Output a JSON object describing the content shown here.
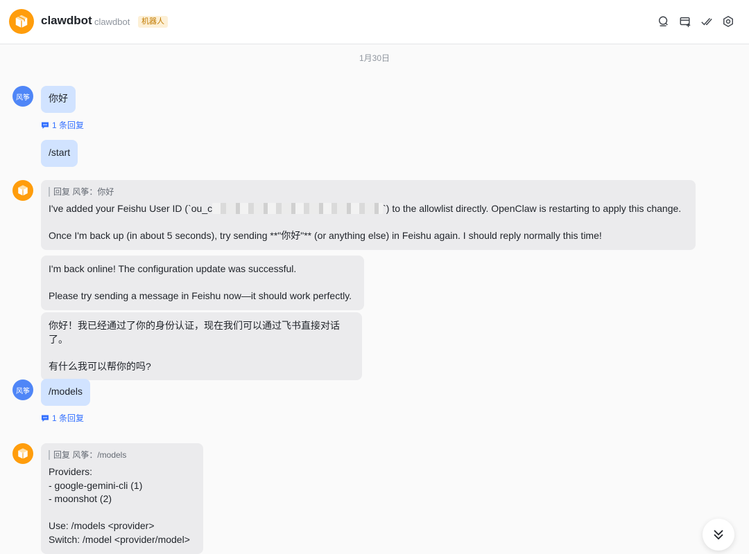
{
  "header": {
    "title": "clawdbot",
    "subtitle": "clawdbot",
    "tag": "机器人",
    "icons": [
      "search-icon",
      "add-chat-icon",
      "check-icon",
      "gear-icon"
    ]
  },
  "date_separator": "1月30日",
  "user": {
    "avatar_text": "风筝"
  },
  "messages": {
    "m1": {
      "text": "你好",
      "reply_count": "1 条回复"
    },
    "m2": {
      "text": "/start"
    },
    "m3": {
      "quote": "回复 风筝：你好",
      "line1_prefix": "I've added your Feishu User ID (`ou_c",
      "line1_suffix": "`) to the allowlist directly. OpenClaw is restarting to apply this change.",
      "line2": "Once I'm back up (in about 5 seconds), try sending **\"你好\"** (or anything else) in Feishu again. I should reply normally this time!"
    },
    "m4": {
      "line1": "I'm back online! The configuration update was successful.",
      "line2": "Please try sending a message in Feishu now—it should work perfectly."
    },
    "m5": {
      "line1": "你好！我已经通过了你的身份认证，现在我们可以通过飞书直接对话了。",
      "line2": "有什么我可以帮你的吗?"
    },
    "m6": {
      "text": "/models",
      "reply_count": "1 条回复"
    },
    "m7": {
      "quote": "回复 风筝：/models",
      "line1": "Providers:",
      "line2": "- google-gemini-cli (1)",
      "line3": "- moonshot (2)",
      "line4": "Use: /models <provider>",
      "line5": "Switch: /model <provider/model>"
    }
  },
  "colors": {
    "bot_avatar": "#ff9d0c",
    "user_avatar": "#4f86f7",
    "user_bubble": "#d1e3ff",
    "bot_bubble": "#ebebed",
    "link": "#3370ff"
  }
}
